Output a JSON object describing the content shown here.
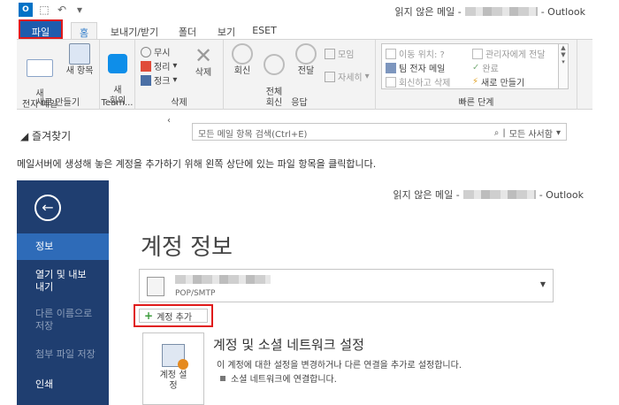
{
  "top": {
    "title_prefix": "읽지 않은 메일 -",
    "title_suffix": "- Outlook",
    "logo_text": "O",
    "tabs": [
      "파일",
      "홈",
      "보내기/받기",
      "폴더",
      "보기",
      "ESET"
    ],
    "groups": {
      "new": {
        "label": "새로 만들기",
        "new_mail": "새\n전자 메일",
        "new_items": "새 항목"
      },
      "team": {
        "label": "Team...",
        "meeting": "새\n회의"
      },
      "delete": {
        "label": "삭제",
        "ignore": "무시",
        "cleanup": "정리",
        "junk": "정크",
        "delete": "삭제"
      },
      "respond": {
        "label": "응답",
        "reply": "회신",
        "reply_all": "전체\n회신",
        "forward": "전달",
        "meeting": "모임",
        "more": "자세히"
      },
      "quicksteps": {
        "label": "빠른 단계",
        "items": [
          "이동 위치: ?",
          "팀 전자 메일",
          "회신하고 삭제",
          "관리자에게 전달",
          "완료",
          "새로 만들기"
        ]
      }
    },
    "favorites_label": "◢ 즐겨찾기",
    "search_placeholder": "모든 메일 항목 검색(Ctrl+E)",
    "search_scope": "모든 사서함"
  },
  "caption": "메일서버에 생성해 놓은 계정을 추가하기 위해 왼쪽 상단에 있는 파일 항목을 클릭합니다.",
  "backstage": {
    "title_prefix": "읽지 않은 메일 -",
    "title_suffix": "- Outlook",
    "nav": [
      "정보",
      "열기 및 내보내기",
      "다른 이름으로 저장",
      "첨부 파일 저장",
      "인쇄"
    ],
    "page_title": "계정 정보",
    "account_type": "POP/SMTP",
    "add_account": "계정 추가",
    "settings_tile": "계정 설\n정",
    "settings_heading": "계정 및 소셜 네트워크 설정",
    "settings_desc": "이 계정에 대한 설정을 변경하거나 다른 연결을 추가로 설정합니다.",
    "settings_bullet": "소셜 네트워크에 연결합니다."
  },
  "colors": {
    "ribbon_bg": "#f3f3f3",
    "file_tab": "#1e5cad",
    "highlight": "#e01a1a",
    "backstage_nav": "#1f3e70",
    "backstage_active": "#2e6bb8"
  }
}
